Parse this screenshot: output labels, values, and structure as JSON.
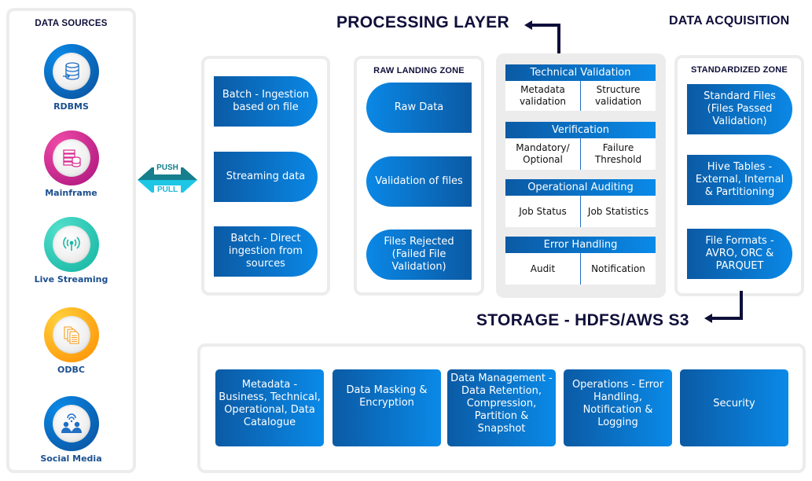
{
  "data_sources": {
    "title": "DATA SOURCES",
    "items": [
      {
        "label": "RDBMS",
        "icon": "database-import-icon",
        "color_a": "#0a8ae8",
        "color_b": "#0b4f99"
      },
      {
        "label": "Mainframe",
        "icon": "server-database-icon",
        "color_a": "#e5369a",
        "color_b": "#a8127a"
      },
      {
        "label": "Live Streaming",
        "icon": "broadcast-antenna-icon",
        "color_a": "#3fd9c3",
        "color_b": "#12b3a0"
      },
      {
        "label": "ODBC",
        "icon": "documents-icon",
        "color_a": "#ffc107",
        "color_b": "#ff8c00"
      },
      {
        "label": "Social Media",
        "icon": "people-wifi-icon",
        "color_a": "#0a8ae8",
        "color_b": "#0b4f99"
      }
    ]
  },
  "push_pull": {
    "push": "PUSH",
    "pull": "PULL"
  },
  "ingestion": {
    "items": [
      "Batch - Ingestion based on file",
      "Streaming data",
      "Batch - Direct ingestion from sources"
    ]
  },
  "raw_landing_zone": {
    "title": "RAW LANDING ZONE",
    "items": [
      "Raw Data",
      "Validation of files",
      "Files Rejected (Failed File Validation)"
    ]
  },
  "processing_layer": {
    "title": "PROCESSING LAYER",
    "cards": [
      {
        "header": "Technical Validation",
        "cells": [
          "Metadata validation",
          "Structure validation"
        ]
      },
      {
        "header": "Verification",
        "cells": [
          "Mandatory/ Optional",
          "Failure Threshold"
        ]
      },
      {
        "header": "Operational Auditing",
        "cells": [
          "Job Status",
          "Job Statistics"
        ]
      },
      {
        "header": "Error Handling",
        "cells": [
          "Audit",
          "Notification"
        ]
      }
    ]
  },
  "data_acquisition": {
    "title": "DATA ACQUISITION"
  },
  "standardized_zone": {
    "title": "STANDARDIZED ZONE",
    "items": [
      "Standard Files (Files Passed Validation)",
      "Hive Tables - External, Internal & Partitioning",
      "File Formats - AVRO, ORC & PARQUET"
    ]
  },
  "storage": {
    "title": "STORAGE - HDFS/AWS S3"
  },
  "governance": {
    "tiles": [
      "Metadata - Business, Technical, Operational, Data Catalogue",
      "Data Masking & Encryption",
      "Data Management - Data Retention, Compression, Partition & Snapshot",
      "Operations - Error Handling, Notification & Logging",
      "Security"
    ]
  }
}
